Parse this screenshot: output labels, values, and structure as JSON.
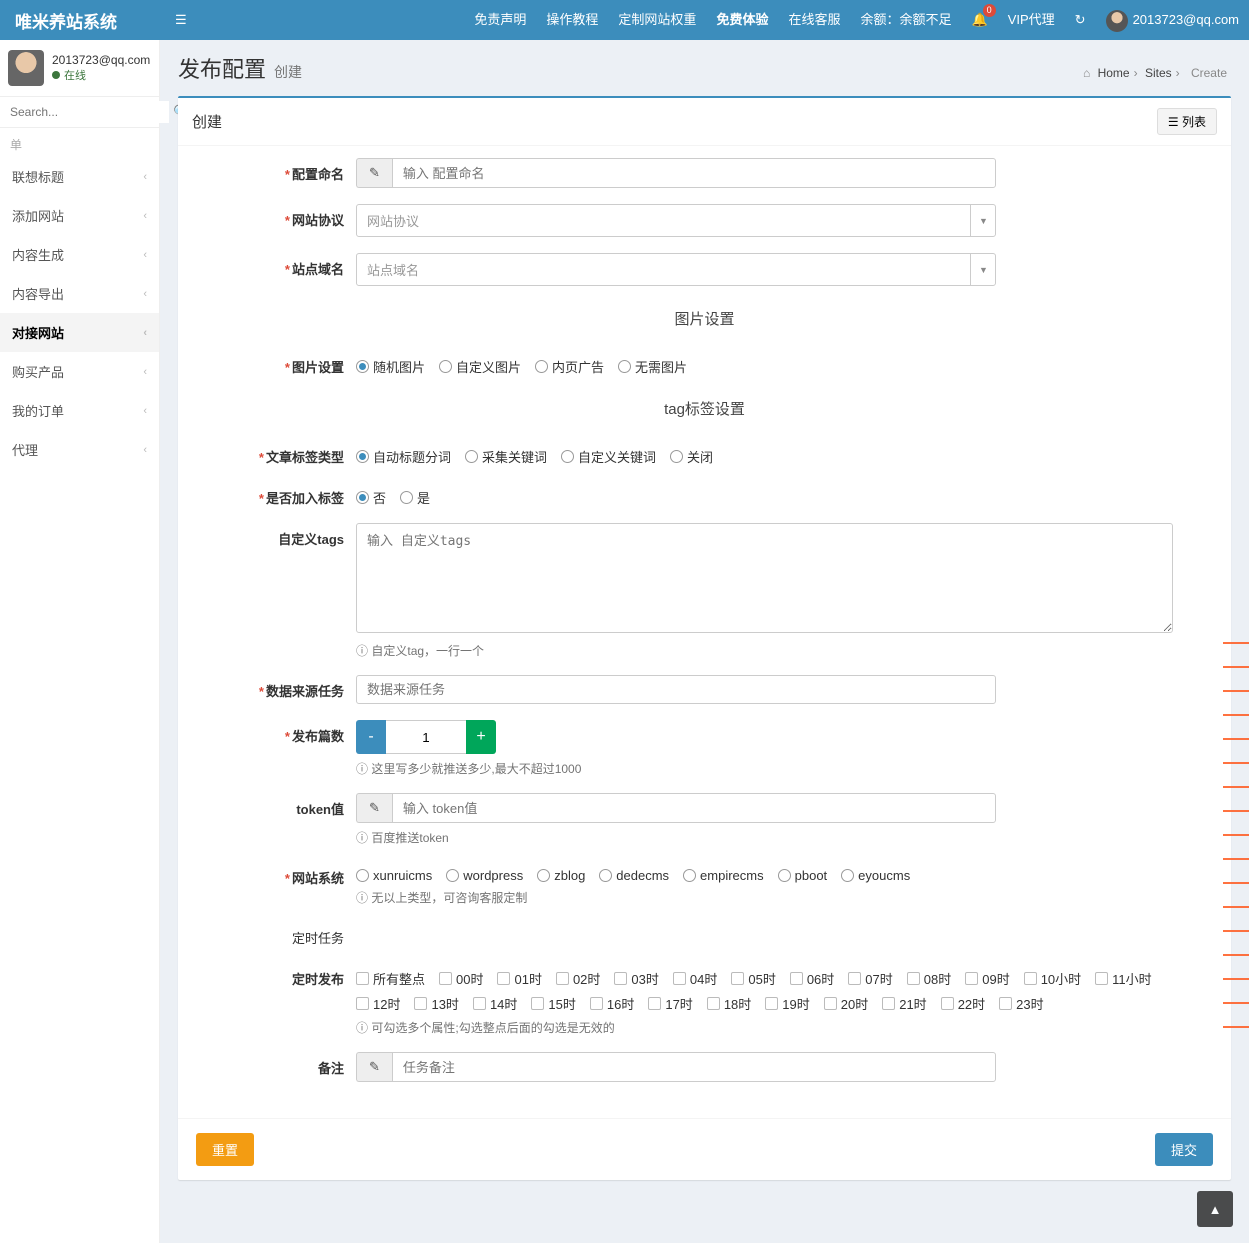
{
  "brand": "唯米养站系统",
  "nav": {
    "disclaimer": "免责声明",
    "tutorial": "操作教程",
    "weight": "定制网站权重",
    "trial": "免费体验",
    "support": "在线客服",
    "balance_label": "余额：",
    "balance_value": "余额不足",
    "vip": "VIP代理",
    "user_email": "2013723@qq.com",
    "notif_count": "0"
  },
  "user": {
    "email": "2013723@qq.com",
    "status": "在线"
  },
  "search": {
    "placeholder": "Search..."
  },
  "menu": {
    "header": "单",
    "items": [
      "联想标题",
      "添加网站",
      "内容生成",
      "内容导出",
      "对接网站",
      "购买产品",
      "我的订单",
      "代理"
    ],
    "active_index": 4
  },
  "page": {
    "title": "发布配置",
    "subtitle": "创建"
  },
  "crumb": {
    "home": "Home",
    "sites": "Sites",
    "create": "Create",
    "home_icon": "⌂"
  },
  "box": {
    "title": "创建",
    "list_btn": "☰ 列表"
  },
  "form": {
    "name": {
      "label": "配置命名",
      "ph": "输入 配置命名"
    },
    "protocol": {
      "label": "网站协议",
      "ph": "网站协议"
    },
    "domain": {
      "label": "站点域名",
      "ph": "站点域名"
    },
    "img_section": "图片设置",
    "img": {
      "label": "图片设置",
      "options": [
        "随机图片",
        "自定义图片",
        "内页广告",
        "无需图片"
      ],
      "checked": 0
    },
    "tag_section": "tag标签设置",
    "tagtype": {
      "label": "文章标签类型",
      "options": [
        "自动标题分词",
        "采集关键词",
        "自定义关键词",
        "关闭"
      ],
      "checked": 0
    },
    "addtag": {
      "label": "是否加入标签",
      "options": [
        "否",
        "是"
      ],
      "checked": 0
    },
    "customtags": {
      "label": "自定义tags",
      "ph": "输入 自定义tags",
      "help": "自定义tag，一行一个"
    },
    "source": {
      "label": "数据来源任务",
      "ph": "数据来源任务"
    },
    "count": {
      "label": "发布篇数",
      "value": "1",
      "help": "这里写多少就推送多少,最大不超过1000"
    },
    "token": {
      "label": "token值",
      "ph": "输入 token值",
      "help": "百度推送token"
    },
    "cms": {
      "label": "网站系统",
      "options": [
        "xunruicms",
        "wordpress",
        "zblog",
        "dedecms",
        "empirecms",
        "pboot",
        "eyoucms"
      ],
      "help": "无以上类型，可咨询客服定制"
    },
    "cron_section": "定时任务",
    "cron": {
      "label": "定时发布",
      "options": [
        "所有整点",
        "00时",
        "01时",
        "02时",
        "03时",
        "04时",
        "05时",
        "06时",
        "07时",
        "08时",
        "09时",
        "10小时",
        "11小时",
        "12时",
        "13时",
        "14时",
        "15时",
        "16时",
        "17时",
        "18时",
        "19时",
        "20时",
        "21时",
        "22时",
        "23时"
      ],
      "help": "可勾选多个属性;勾选整点后面的勾选是无效的"
    },
    "remark": {
      "label": "备注",
      "ph": "任务备注"
    }
  },
  "buttons": {
    "reset": "重置",
    "submit": "提交"
  },
  "icons": {
    "pencil": "✎",
    "info": "ⓘ",
    "bell": "🔔",
    "refresh": "↻",
    "up": "▲"
  }
}
